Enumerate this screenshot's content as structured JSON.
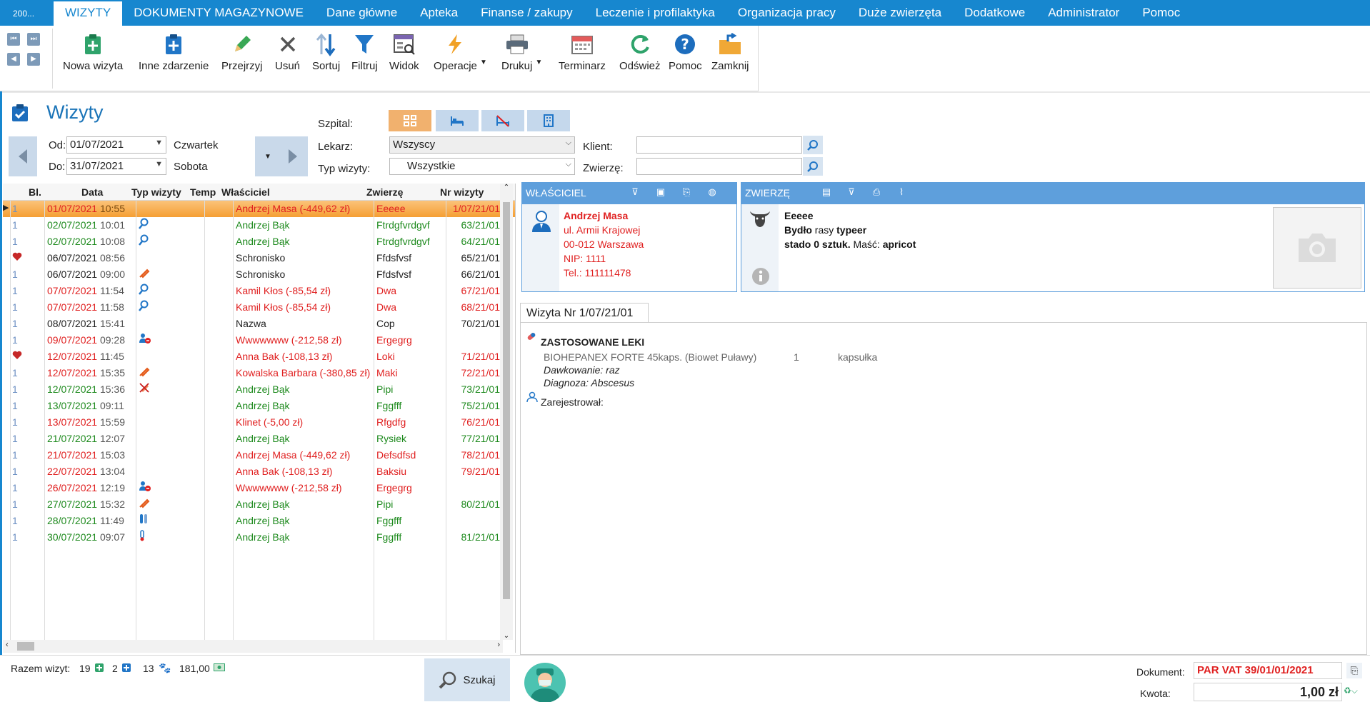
{
  "menu": {
    "app_label": "200...",
    "items": [
      "WIZYTY",
      "DOKUMENTY MAGAZYNOWE",
      "Dane główne",
      "Apteka",
      "Finanse / zakupy",
      "Leczenie i profilaktyka",
      "Organizacja pracy",
      "Duże zwierzęta",
      "Dodatkowe",
      "Administrator",
      "Pomoc"
    ]
  },
  "ribbon": {
    "buttons": [
      "Nowa wizyta",
      "Inne zdarzenie",
      "Przejrzyj",
      "Usuń",
      "Sortuj",
      "Filtruj",
      "Widok",
      "Operacje",
      "Drukuj",
      "Terminarz",
      "Odśwież",
      "Pomoc",
      "Zamknij"
    ]
  },
  "page": {
    "title": "Wizyty",
    "od_label": "Od:",
    "od_value": "01/07/2021",
    "od_day": "Czwartek",
    "do_label": "Do:",
    "do_value": "31/07/2021",
    "do_day": "Sobota",
    "szpital_label": "Szpital:",
    "lekarz_label": "Lekarz:",
    "lekarz_value": "Wszyscy",
    "typ_label": "Typ wizyty:",
    "typ_value": "Wszystkie",
    "klient_label": "Klient:",
    "klient_value": "",
    "zwierze_label": "Zwierzę:",
    "zwierze_value": ""
  },
  "grid": {
    "headers": [
      "Bl.",
      "Data",
      "Typ wizyty",
      "Temp",
      "Właściciel",
      "Zwierzę",
      "Nr wizyty"
    ],
    "rows": [
      {
        "bl": "1",
        "date": "01/07/2021",
        "time": "10:55",
        "type": "",
        "owner": "Andrzej Masa (-449,62 zł)",
        "animal": "Eeeee",
        "nr": "1/07/21/01",
        "color": "#e02020",
        "sel": true
      },
      {
        "bl": "1",
        "date": "02/07/2021",
        "time": "10:01",
        "type": "search",
        "owner": "Andrzej Bąk",
        "animal": "Ftrdgfvrdgvf",
        "nr": "63/21/01",
        "color": "#1e8a1e"
      },
      {
        "bl": "1",
        "date": "02/07/2021",
        "time": "10:08",
        "type": "search",
        "owner": "Andrzej Bąk",
        "animal": "Ftrdgfvrdgvf",
        "nr": "64/21/01",
        "color": "#1e8a1e"
      },
      {
        "bl": "heart",
        "date": "06/07/2021",
        "time": "08:56",
        "type": "",
        "owner": "Schronisko",
        "animal": "Ffdsfvsf",
        "nr": "65/21/01",
        "color": "#222222"
      },
      {
        "bl": "1",
        "date": "06/07/2021",
        "time": "09:00",
        "type": "syringe",
        "owner": "Schronisko",
        "animal": "Ffdsfvsf",
        "nr": "66/21/01",
        "color": "#222222"
      },
      {
        "bl": "1",
        "date": "07/07/2021",
        "time": "11:54",
        "type": "search",
        "owner": "Kamil Kłos (-85,54 zł)",
        "animal": "Dwa",
        "nr": "67/21/01",
        "color": "#e02020"
      },
      {
        "bl": "1",
        "date": "07/07/2021",
        "time": "11:58",
        "type": "search",
        "owner": "Kamil Kłos (-85,54 zł)",
        "animal": "Dwa",
        "nr": "68/21/01",
        "color": "#e02020"
      },
      {
        "bl": "1",
        "date": "08/07/2021",
        "time": "15:41",
        "type": "",
        "owner": "Nazwa",
        "animal": "Cop",
        "nr": "70/21/01",
        "color": "#222222"
      },
      {
        "bl": "1",
        "date": "09/07/2021",
        "time": "09:28",
        "type": "user",
        "owner": "Wwwwwww (-212,58 zł)",
        "animal": "Ergegrg",
        "nr": "",
        "color": "#e02020"
      },
      {
        "bl": "heart",
        "date": "12/07/2021",
        "time": "11:45",
        "type": "",
        "owner": "Anna Bak (-108,13 zł)",
        "animal": "Loki",
        "nr": "71/21/01",
        "color": "#e02020"
      },
      {
        "bl": "1",
        "date": "12/07/2021",
        "time": "15:35",
        "type": "syringe",
        "owner": "Kowalska Barbara (-380,85 zł)",
        "animal": "Maki",
        "nr": "72/21/01",
        "color": "#e02020"
      },
      {
        "bl": "1",
        "date": "12/07/2021",
        "time": "15:36",
        "type": "nosyringe",
        "owner": "Andrzej Bąk",
        "animal": "Pipi",
        "nr": "73/21/01",
        "color": "#1e8a1e"
      },
      {
        "bl": "1",
        "date": "13/07/2021",
        "time": "09:11",
        "type": "",
        "owner": "Andrzej Bąk",
        "animal": "Fggfff",
        "nr": "75/21/01",
        "color": "#1e8a1e"
      },
      {
        "bl": "1",
        "date": "13/07/2021",
        "time": "15:59",
        "type": "",
        "owner": "Klinet (-5,00 zł)",
        "animal": "Rfgdfg",
        "nr": "76/21/01",
        "color": "#e02020"
      },
      {
        "bl": "1",
        "date": "21/07/2021",
        "time": "12:07",
        "type": "",
        "owner": "Andrzej Bąk",
        "animal": "Rysiek",
        "nr": "77/21/01",
        "color": "#1e8a1e"
      },
      {
        "bl": "1",
        "date": "21/07/2021",
        "time": "15:03",
        "type": "",
        "owner": "Andrzej Masa (-449,62 zł)",
        "animal": "Defsdfsd",
        "nr": "78/21/01",
        "color": "#e02020"
      },
      {
        "bl": "1",
        "date": "22/07/2021",
        "time": "13:04",
        "type": "",
        "owner": "Anna Bak (-108,13 zł)",
        "animal": "Baksiu",
        "nr": "79/21/01",
        "color": "#e02020"
      },
      {
        "bl": "1",
        "date": "26/07/2021",
        "time": "12:19",
        "type": "user",
        "owner": "Wwwwwww (-212,58 zł)",
        "animal": "Ergegrg",
        "nr": "",
        "color": "#e02020"
      },
      {
        "bl": "1",
        "date": "27/07/2021",
        "time": "15:32",
        "type": "syringe",
        "owner": "Andrzej Bąk",
        "animal": "Pipi",
        "nr": "80/21/01",
        "color": "#1e8a1e"
      },
      {
        "bl": "1",
        "date": "28/07/2021",
        "time": "11:49",
        "type": "tubes",
        "owner": "Andrzej Bąk",
        "animal": "Fggfff",
        "nr": "",
        "color": "#1e8a1e"
      },
      {
        "bl": "1",
        "date": "30/07/2021",
        "time": "09:07",
        "type": "thermo",
        "owner": "Andrzej Bąk",
        "animal": "Fggfff",
        "nr": "81/21/01",
        "color": "#1e8a1e"
      }
    ]
  },
  "owner_panel": {
    "header": "WŁAŚCICIEL",
    "name": "Andrzej Masa",
    "street": "ul. Armii Krajowej",
    "city": "00-012  Warszawa",
    "nip": "NIP: 1111",
    "tel": "Tel.: 111111478"
  },
  "animal_panel": {
    "header": "ZWIERZĘ",
    "name": "Eeeee",
    "species": "Bydło",
    "rasy": "rasy",
    "breed": "typeer",
    "herd": "stado 0 sztuk.",
    "masc_label": "Maść:",
    "masc_value": "apricot"
  },
  "visit": {
    "tab": "Wizyta Nr 1/07/21/01",
    "section": "ZASTOSOWANE LEKI",
    "drug": "BIOHEPANEX FORTE 45kaps. (Biowet Puławy)",
    "qty": "1",
    "unit": "kapsułka",
    "dawkowanie": "Dawkowanie: raz",
    "diagnoza": "Diagnoza: Abscesus",
    "registered": "Zarejestrował:"
  },
  "status": {
    "razem_label": "Razem wizyt:",
    "count_visits": "19",
    "count_other": "2",
    "count_animals": "13",
    "sum": "181,00",
    "search_label": "Szukaj",
    "dokument_label": "Dokument:",
    "dokument_value": "PAR VAT 39/01/01/2021",
    "kwota_label": "Kwota:",
    "kwota_value": "1,00 zł"
  }
}
